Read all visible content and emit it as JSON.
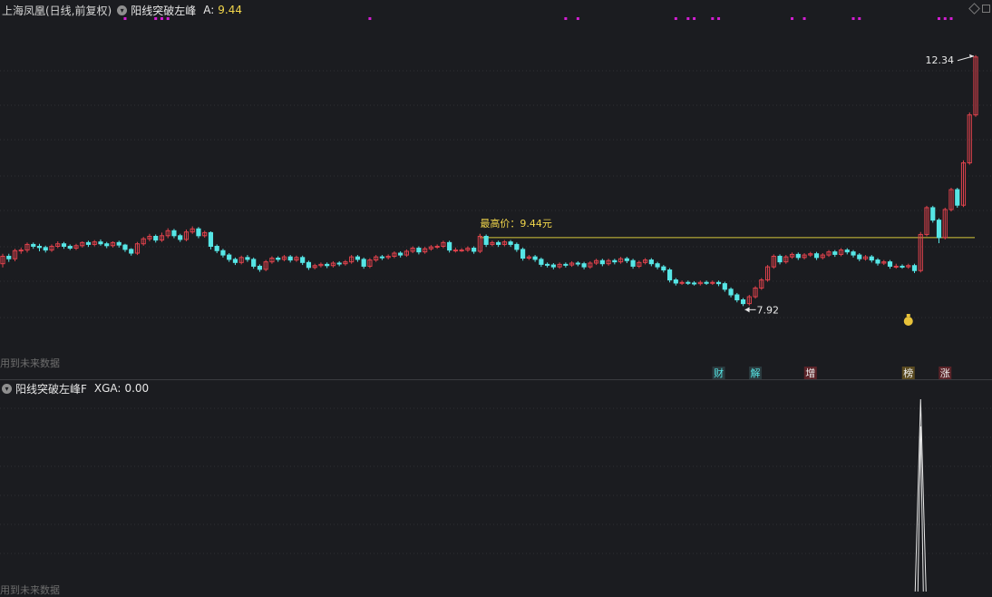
{
  "header": {
    "title": "上海凤凰(日线,前复权)",
    "indicator_name": "阳线突破左峰",
    "value_label": "A:",
    "value": "9.44"
  },
  "sub_header": {
    "indicator_name": "阳线突破左峰F",
    "value_label": "XGA:",
    "value": "0.00"
  },
  "watermark": "用到未来数据",
  "colors": {
    "background": "#1b1c20",
    "up_candle": "#e0424c",
    "down_candle": "#56e6e6",
    "resistance_line": "#d6c93a",
    "annotation_text": "#f2d64b",
    "magenta_dots": "#d21ed2",
    "grid": "#2f3035",
    "subchart_line": "#e8e8e8"
  },
  "annotations": {
    "high_price": "最高价：9.44元",
    "max_label": "12.34",
    "min_label": "7.92"
  },
  "event_tags": [
    {
      "char": "财",
      "color": "#56e6e6",
      "bg": "#2a3a3e"
    },
    {
      "char": "解",
      "color": "#56e6e6",
      "bg": "#2a3a3e"
    },
    {
      "char": "增",
      "color": "#f0f0f0",
      "bg": "#5a2328"
    },
    {
      "char": "榜",
      "color": "#f0f0f0",
      "bg": "#5a4a20"
    },
    {
      "char": "涨",
      "color": "#f0f0f0",
      "bg": "#5a2328"
    }
  ],
  "icons": {
    "indicator_toggle": "circle-chevron-down-icon",
    "money_bag": "money-bag-icon"
  },
  "chart_data": {
    "type": "candlestick",
    "price_range": [
      7.5,
      12.6
    ],
    "resistance_level": 9.44,
    "candles": [
      [
        9.02,
        9.14,
        8.96,
        9.18
      ],
      [
        9.14,
        9.1,
        9.05,
        9.18
      ],
      [
        9.1,
        9.23,
        9.06,
        9.26
      ],
      [
        9.23,
        9.24,
        9.18,
        9.28
      ],
      [
        9.24,
        9.33,
        9.2,
        9.36
      ],
      [
        9.33,
        9.3,
        9.26,
        9.36
      ],
      [
        9.3,
        9.28,
        9.22,
        9.34
      ],
      [
        9.28,
        9.24,
        9.2,
        9.31
      ],
      [
        9.24,
        9.3,
        9.21,
        9.33
      ],
      [
        9.3,
        9.34,
        9.27,
        9.38
      ],
      [
        9.34,
        9.3,
        9.26,
        9.37
      ],
      [
        9.3,
        9.27,
        9.24,
        9.33
      ],
      [
        9.27,
        9.31,
        9.24,
        9.34
      ],
      [
        9.31,
        9.36,
        9.28,
        9.38
      ],
      [
        9.36,
        9.33,
        9.29,
        9.39
      ],
      [
        9.33,
        9.37,
        9.3,
        9.4
      ],
      [
        9.37,
        9.34,
        9.31,
        9.41
      ],
      [
        9.34,
        9.31,
        9.27,
        9.37
      ],
      [
        9.31,
        9.36,
        9.28,
        9.38
      ],
      [
        9.36,
        9.32,
        9.28,
        9.39
      ],
      [
        9.32,
        9.25,
        9.21,
        9.34
      ],
      [
        9.25,
        9.19,
        9.15,
        9.27
      ],
      [
        9.19,
        9.34,
        9.16,
        9.37
      ],
      [
        9.34,
        9.42,
        9.31,
        9.45
      ],
      [
        9.42,
        9.46,
        9.38,
        9.5
      ],
      [
        9.46,
        9.4,
        9.36,
        9.49
      ],
      [
        9.4,
        9.47,
        9.37,
        9.52
      ],
      [
        9.47,
        9.55,
        9.43,
        9.59
      ],
      [
        9.55,
        9.47,
        9.43,
        9.58
      ],
      [
        9.47,
        9.41,
        9.37,
        9.5
      ],
      [
        9.41,
        9.53,
        9.38,
        9.57
      ],
      [
        9.53,
        9.58,
        9.5,
        9.62
      ],
      [
        9.58,
        9.47,
        9.43,
        9.61
      ],
      [
        9.47,
        9.52,
        9.44,
        9.55
      ],
      [
        9.52,
        9.3,
        9.25,
        9.54
      ],
      [
        9.3,
        9.23,
        9.19,
        9.33
      ],
      [
        9.23,
        9.16,
        9.12,
        9.26
      ],
      [
        9.16,
        9.09,
        9.05,
        9.19
      ],
      [
        9.09,
        9.04,
        9.0,
        9.12
      ],
      [
        9.04,
        9.12,
        9.01,
        9.15
      ],
      [
        9.12,
        9.09,
        9.05,
        9.16
      ],
      [
        9.09,
        8.98,
        8.94,
        9.12
      ],
      [
        8.98,
        8.93,
        8.89,
        9.01
      ],
      [
        8.93,
        9.05,
        8.9,
        9.08
      ],
      [
        9.05,
        9.11,
        9.02,
        9.14
      ],
      [
        9.11,
        9.09,
        9.05,
        9.14
      ],
      [
        9.09,
        9.13,
        9.06,
        9.16
      ],
      [
        9.13,
        9.08,
        9.04,
        9.16
      ],
      [
        9.08,
        9.12,
        9.05,
        9.15
      ],
      [
        9.12,
        9.04,
        9.0,
        9.15
      ],
      [
        9.04,
        8.96,
        8.92,
        9.07
      ],
      [
        8.96,
        8.99,
        8.93,
        9.02
      ],
      [
        8.99,
        9.01,
        8.96,
        9.04
      ],
      [
        9.01,
        8.99,
        8.95,
        9.04
      ],
      [
        8.99,
        9.03,
        8.96,
        9.06
      ],
      [
        9.03,
        9.02,
        8.98,
        9.06
      ],
      [
        9.02,
        9.05,
        8.99,
        9.08
      ],
      [
        9.05,
        9.13,
        9.02,
        9.16
      ],
      [
        9.13,
        9.09,
        9.05,
        9.16
      ],
      [
        9.09,
        8.98,
        8.94,
        9.12
      ],
      [
        8.98,
        9.08,
        8.95,
        9.11
      ],
      [
        9.08,
        9.13,
        9.05,
        9.16
      ],
      [
        9.13,
        9.12,
        9.08,
        9.16
      ],
      [
        9.12,
        9.14,
        9.09,
        9.17
      ],
      [
        9.14,
        9.19,
        9.11,
        9.22
      ],
      [
        9.19,
        9.16,
        9.12,
        9.22
      ],
      [
        9.16,
        9.22,
        9.13,
        9.25
      ],
      [
        9.22,
        9.27,
        9.19,
        9.3
      ],
      [
        9.27,
        9.21,
        9.17,
        9.3
      ],
      [
        9.21,
        9.26,
        9.18,
        9.29
      ],
      [
        9.26,
        9.29,
        9.23,
        9.32
      ],
      [
        9.29,
        9.3,
        9.26,
        9.33
      ],
      [
        9.3,
        9.36,
        9.27,
        9.39
      ],
      [
        9.36,
        9.24,
        9.2,
        9.39
      ],
      [
        9.24,
        9.24,
        9.2,
        9.28
      ],
      [
        9.24,
        9.24,
        9.21,
        9.27
      ],
      [
        9.24,
        9.27,
        9.21,
        9.3
      ],
      [
        9.27,
        9.22,
        9.18,
        9.3
      ],
      [
        9.22,
        9.46,
        9.19,
        9.5
      ],
      [
        9.46,
        9.33,
        9.29,
        9.49
      ],
      [
        9.33,
        9.36,
        9.3,
        9.39
      ],
      [
        9.36,
        9.33,
        9.29,
        9.39
      ],
      [
        9.33,
        9.37,
        9.3,
        9.4
      ],
      [
        9.37,
        9.33,
        9.29,
        9.4
      ],
      [
        9.33,
        9.25,
        9.21,
        9.36
      ],
      [
        9.25,
        9.11,
        9.07,
        9.28
      ],
      [
        9.11,
        9.13,
        9.08,
        9.16
      ],
      [
        9.13,
        9.09,
        9.05,
        9.16
      ],
      [
        9.09,
        9.01,
        8.97,
        9.12
      ],
      [
        9.01,
        9.0,
        8.96,
        9.04
      ],
      [
        9.0,
        8.97,
        8.93,
        9.03
      ],
      [
        8.97,
        9.01,
        8.94,
        9.04
      ],
      [
        9.01,
        9.0,
        8.96,
        9.04
      ],
      [
        9.0,
        9.03,
        8.97,
        9.06
      ],
      [
        9.03,
        9.02,
        8.98,
        9.06
      ],
      [
        9.02,
        8.97,
        8.93,
        9.05
      ],
      [
        8.97,
        9.03,
        8.94,
        9.06
      ],
      [
        9.03,
        9.07,
        9.0,
        9.1
      ],
      [
        9.07,
        9.02,
        8.98,
        9.1
      ],
      [
        9.02,
        9.07,
        8.99,
        9.1
      ],
      [
        9.07,
        9.05,
        9.01,
        9.1
      ],
      [
        9.05,
        9.1,
        9.02,
        9.13
      ],
      [
        9.1,
        9.07,
        9.03,
        9.13
      ],
      [
        9.07,
        8.98,
        8.94,
        9.1
      ],
      [
        8.98,
        9.04,
        8.95,
        9.07
      ],
      [
        9.04,
        9.08,
        9.01,
        9.11
      ],
      [
        9.08,
        9.02,
        8.98,
        9.11
      ],
      [
        9.02,
        8.97,
        8.93,
        9.05
      ],
      [
        8.97,
        8.92,
        8.88,
        9.0
      ],
      [
        8.92,
        8.76,
        8.72,
        8.95
      ],
      [
        8.76,
        8.71,
        8.67,
        8.79
      ],
      [
        8.71,
        8.72,
        8.68,
        8.75
      ],
      [
        8.72,
        8.71,
        8.68,
        8.75
      ],
      [
        8.71,
        8.7,
        8.67,
        8.74
      ],
      [
        8.7,
        8.72,
        8.67,
        8.75
      ],
      [
        8.72,
        8.71,
        8.68,
        8.75
      ],
      [
        8.71,
        8.72,
        8.68,
        8.75
      ],
      [
        8.72,
        8.7,
        8.66,
        8.75
      ],
      [
        8.7,
        8.61,
        8.57,
        8.73
      ],
      [
        8.61,
        8.52,
        8.48,
        8.64
      ],
      [
        8.52,
        8.44,
        8.4,
        8.55
      ],
      [
        8.44,
        8.38,
        8.34,
        8.47
      ],
      [
        8.38,
        8.49,
        8.35,
        8.52
      ],
      [
        8.49,
        8.63,
        8.46,
        8.66
      ],
      [
        8.63,
        8.76,
        8.6,
        8.79
      ],
      [
        8.76,
        8.97,
        8.73,
        9.0
      ],
      [
        8.97,
        9.14,
        8.94,
        9.17
      ],
      [
        9.14,
        9.05,
        9.01,
        9.17
      ],
      [
        9.05,
        9.13,
        9.02,
        9.16
      ],
      [
        9.13,
        9.17,
        9.1,
        9.2
      ],
      [
        9.17,
        9.12,
        9.08,
        9.2
      ],
      [
        9.12,
        9.16,
        9.09,
        9.19
      ],
      [
        9.16,
        9.18,
        9.13,
        9.21
      ],
      [
        9.18,
        9.12,
        9.08,
        9.21
      ],
      [
        9.12,
        9.16,
        9.09,
        9.19
      ],
      [
        9.16,
        9.21,
        9.13,
        9.24
      ],
      [
        9.21,
        9.17,
        9.13,
        9.24
      ],
      [
        9.17,
        9.24,
        9.14,
        9.27
      ],
      [
        9.24,
        9.21,
        9.17,
        9.27
      ],
      [
        9.21,
        9.16,
        9.12,
        9.24
      ],
      [
        9.16,
        9.1,
        9.06,
        9.19
      ],
      [
        9.1,
        9.13,
        9.07,
        9.16
      ],
      [
        9.13,
        9.08,
        9.04,
        9.16
      ],
      [
        9.08,
        9.03,
        8.99,
        9.11
      ],
      [
        9.03,
        9.05,
        9.0,
        9.08
      ],
      [
        9.05,
        8.98,
        8.94,
        9.08
      ],
      [
        8.98,
        8.98,
        8.94,
        9.02
      ],
      [
        8.98,
        8.97,
        8.94,
        9.01
      ],
      [
        8.97,
        8.99,
        8.94,
        9.02
      ],
      [
        8.99,
        8.91,
        8.87,
        9.02
      ],
      [
        8.91,
        9.49,
        8.88,
        9.53
      ],
      [
        9.49,
        9.92,
        9.46,
        9.95
      ],
      [
        9.92,
        9.72,
        9.68,
        9.95
      ],
      [
        9.72,
        9.44,
        9.35,
        9.75
      ],
      [
        9.44,
        9.89,
        9.41,
        9.92
      ],
      [
        9.89,
        10.21,
        9.86,
        10.24
      ],
      [
        10.21,
        9.96,
        9.92,
        10.24
      ],
      [
        9.96,
        10.64,
        9.93,
        10.68
      ],
      [
        10.64,
        11.41,
        10.61,
        11.45
      ],
      [
        11.41,
        12.34,
        11.38,
        12.37
      ]
    ],
    "magenta_marker_candles": [
      20,
      25,
      26,
      27,
      60,
      92,
      94,
      110,
      112,
      113,
      116,
      117,
      129,
      131,
      139,
      140,
      153,
      154,
      155
    ],
    "subchart_type": "line",
    "subchart_range": [
      0,
      1
    ],
    "subchart_spike_candle": 150,
    "subchart_spike_value": 1
  }
}
